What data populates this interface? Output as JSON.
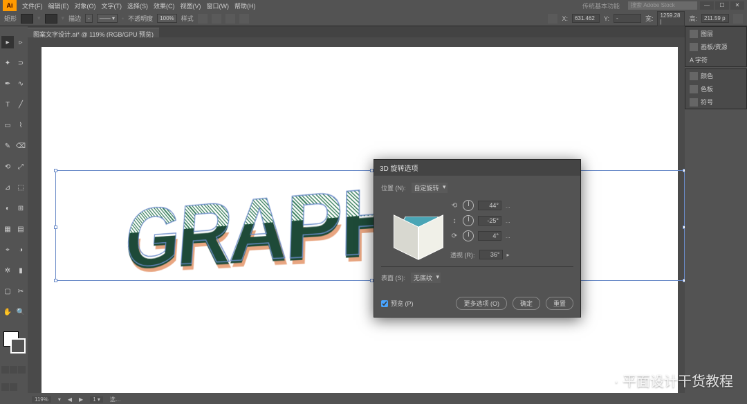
{
  "app": {
    "icon_text": "Ai"
  },
  "menu": [
    "文件(F)",
    "编辑(E)",
    "对象(O)",
    "文字(T)",
    "选择(S)",
    "效果(C)",
    "视图(V)",
    "窗口(W)",
    "帮助(H)"
  ],
  "window": {
    "title": "传统基本功能",
    "search_placeholder": "搜索 Adobe Stock"
  },
  "control": {
    "label": "矩形",
    "stroke_label": "描边",
    "stroke_val": "-",
    "uniform": "不透明度",
    "opacity": "100%",
    "style_label": "样式",
    "transform_x_label": "X:",
    "transform_x": "631.462",
    "transform_y_label": "Y:",
    "transform_y": "-",
    "transform_w_label": "宽:",
    "transform_w": "1259.28 |",
    "transform_h_label": "高:",
    "transform_h": "211.59 p"
  },
  "tab": {
    "label": "图案文字设计.ai* @ 119% (RGB/GPU 预览)"
  },
  "graphic_text": "GRAPHIC",
  "panels": [
    {
      "icon": true,
      "label": "图层"
    },
    {
      "icon": true,
      "label": "画板/资源"
    },
    {
      "icon": true,
      "label": "A 字符"
    },
    "-",
    {
      "icon": true,
      "label": "颜色"
    },
    {
      "icon": true,
      "label": "色板"
    },
    {
      "icon": true,
      "label": "符号"
    }
  ],
  "dialog": {
    "title": "3D 旋转选项",
    "position_label": "位置 (N):",
    "position_value": "自定旋转",
    "angles": [
      {
        "icon": "⟲",
        "value": "44°"
      },
      {
        "icon": "↕",
        "value": "-25°"
      },
      {
        "icon": "⟳",
        "value": "4°"
      }
    ],
    "perspective_label": "透视 (R):",
    "perspective_value": "36°",
    "surface_label": "表面 (S):",
    "surface_value": "无底纹",
    "preview_label": "预览 (P)",
    "btn_more": "更多选项 (O)",
    "btn_ok": "确定",
    "btn_reset": "重置"
  },
  "status": {
    "zoom": "119%",
    "label2": "选…",
    "sel": ""
  },
  "watermark": "· 平面设计干货教程"
}
